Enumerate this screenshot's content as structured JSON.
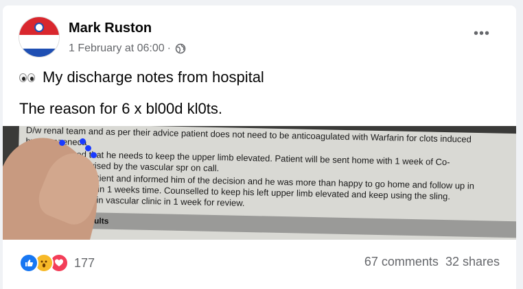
{
  "post": {
    "author": "Mark Ruston",
    "timestamp": "1 February at 06:00",
    "separator": "·",
    "audience_icon": "globe-icon",
    "emoji": "eyes",
    "line1": "My discharge notes from hospital",
    "line2": "The reason for 6 x bl00d kl0ts.",
    "more_menu": "•••"
  },
  "photo": {
    "lines": [
      "D/w renal team and as per their advice patient does not need to be anticoagulated with Warfarin for clots induced",
      "by Astrazeneca",
      "Patient advised that he needs to keep the upper limb elevated. Patient will be sent home with 1 week of Co-",
      "Amoxiclav as advised by the vascular spr on call.",
      "Counselled the patient and informed him of the decision and he was more than happy to go home and follow up in",
      "the vascular clinic in 1 weeks time. Counselled to keep his left upper limb elevated and keep using the sling.",
      "To be followed up in vascular clinic in 1 week for review."
    ],
    "band": "Results"
  },
  "footer": {
    "reaction_icons": [
      "like-icon",
      "wow-icon",
      "love-icon"
    ],
    "reaction_count": "177",
    "comments": "67 comments",
    "shares": "32 shares"
  },
  "colors": {
    "like": "#1877f2",
    "wow": "#f7b928",
    "love": "#f33e58",
    "secondary_text": "#65676b"
  }
}
